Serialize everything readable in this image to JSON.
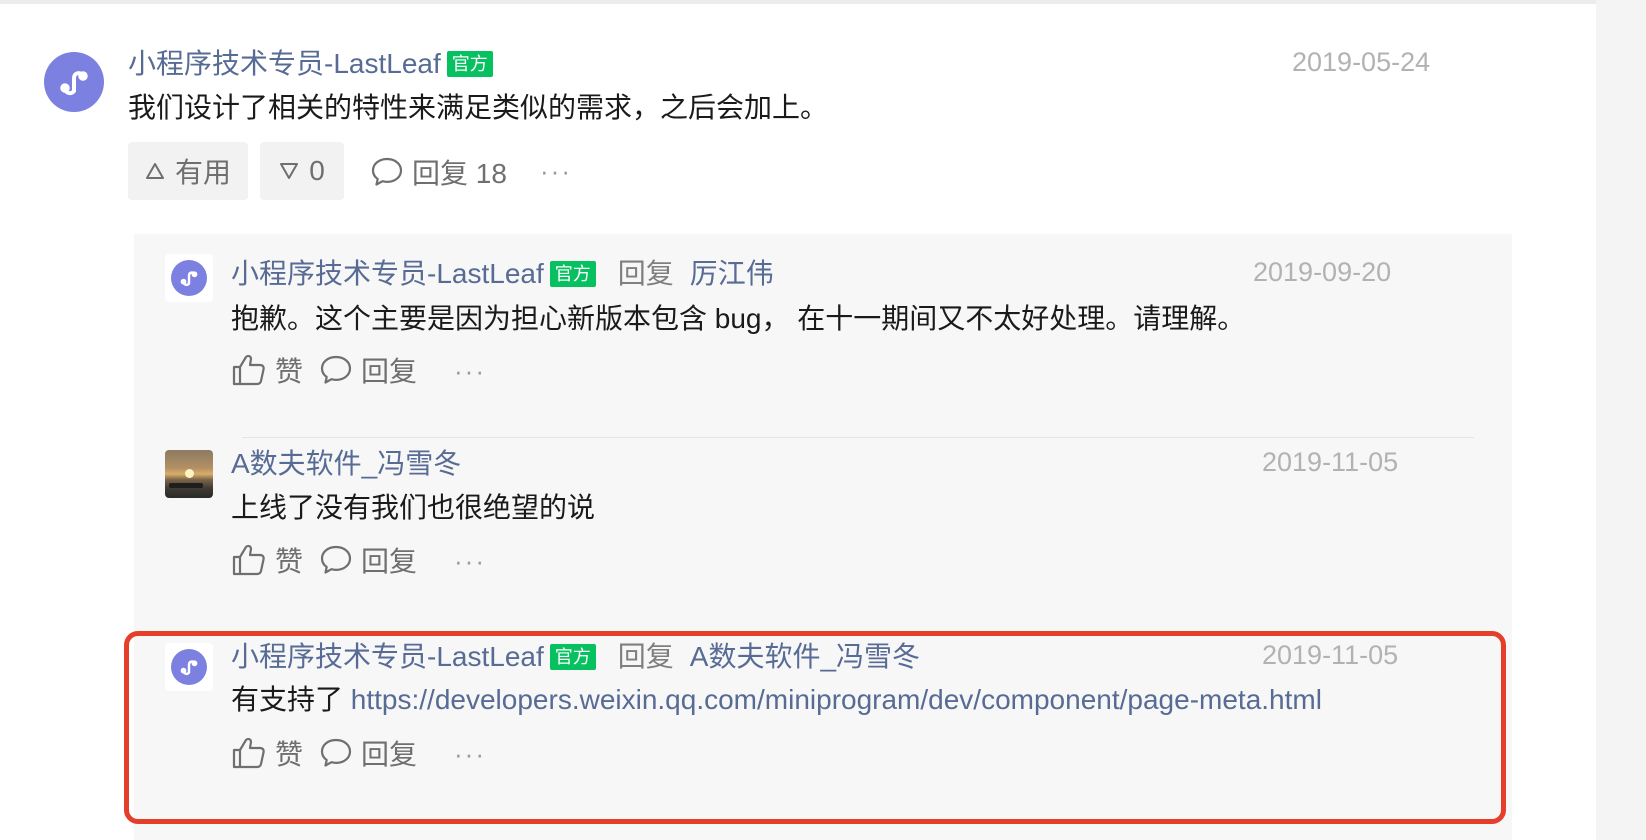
{
  "main_comment": {
    "author": "小程序技术专员-LastLeaf",
    "badge": "官方",
    "date": "2019-05-24",
    "content": "我们设计了相关的特性来满足类似的需求，之后会加上。",
    "useful_label": "有用",
    "down_count": "0",
    "reply_label": "回复 18",
    "more": "···"
  },
  "replies": [
    {
      "author": "小程序技术专员-LastLeaf",
      "badge": "官方",
      "reply_word": "回复",
      "reply_to": "厉江伟",
      "date": "2019-09-20",
      "content": "抱歉。这个主要是因为担心新版本包含 bug， 在十一期间又不太好处理。请理解。",
      "like_label": "赞",
      "reply_label": "回复",
      "more": "···"
    },
    {
      "author": "A数夫软件_冯雪冬",
      "date": "2019-11-05",
      "content": "上线了没有我们也很绝望的说",
      "like_label": "赞",
      "reply_label": "回复",
      "more": "···"
    },
    {
      "author": "小程序技术专员-LastLeaf",
      "badge": "官方",
      "reply_word": "回复",
      "reply_to": "A数夫软件_冯雪冬",
      "date": "2019-11-05",
      "content_prefix": "有支持了",
      "link": "https://developers.weixin.qq.com/miniprogram/dev/component/page-meta.html",
      "like_label": "赞",
      "reply_label": "回复",
      "more": "···"
    }
  ],
  "colors": {
    "link": "#576b95",
    "official_badge": "#07c160",
    "highlight_border": "#e53e2b",
    "avatar": "#7c80e0"
  },
  "icons": [
    "miniprogram-logo-icon",
    "upvote-icon",
    "downvote-icon",
    "comment-bubble-icon",
    "thumbs-up-icon",
    "more-icon"
  ]
}
